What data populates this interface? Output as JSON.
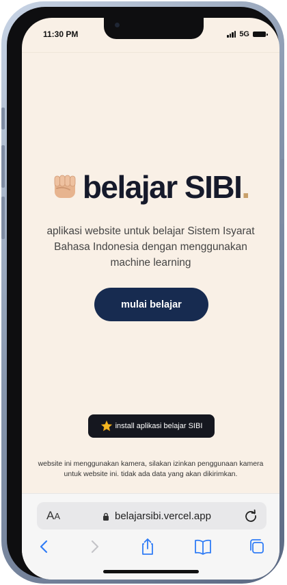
{
  "status_bar": {
    "time": "11:30 PM",
    "network": "5G"
  },
  "hero": {
    "title": "belajar SIBI",
    "title_dot": ".",
    "fist_icon": "raised-fist-emoji",
    "description": "aplikasi website untuk belajar Sistem Isyarat Bahasa Indonesia dengan menggunakan machine learning",
    "start_button_label": "mulai belajar"
  },
  "install": {
    "icon": "star-emoji",
    "label": "install aplikasi belajar SIBI"
  },
  "notice": "website ini menggunakan kamera, silakan izinkan penggunaan kamera untuk website ini. tidak ada data yang akan dikirimkan.",
  "browser": {
    "aa_label_large": "A",
    "aa_label_small": "A",
    "url": "belajarsibi.vercel.app",
    "toolbar_icons": [
      "back-icon",
      "forward-icon",
      "share-icon",
      "bookmarks-icon",
      "tabs-icon"
    ]
  },
  "colors": {
    "background": "#f9f0e6",
    "title": "#161a2b",
    "accent_dot": "#c8a06a",
    "button": "#172b50",
    "install_badge": "#15171f",
    "ios_blue": "#2f7cf6"
  }
}
